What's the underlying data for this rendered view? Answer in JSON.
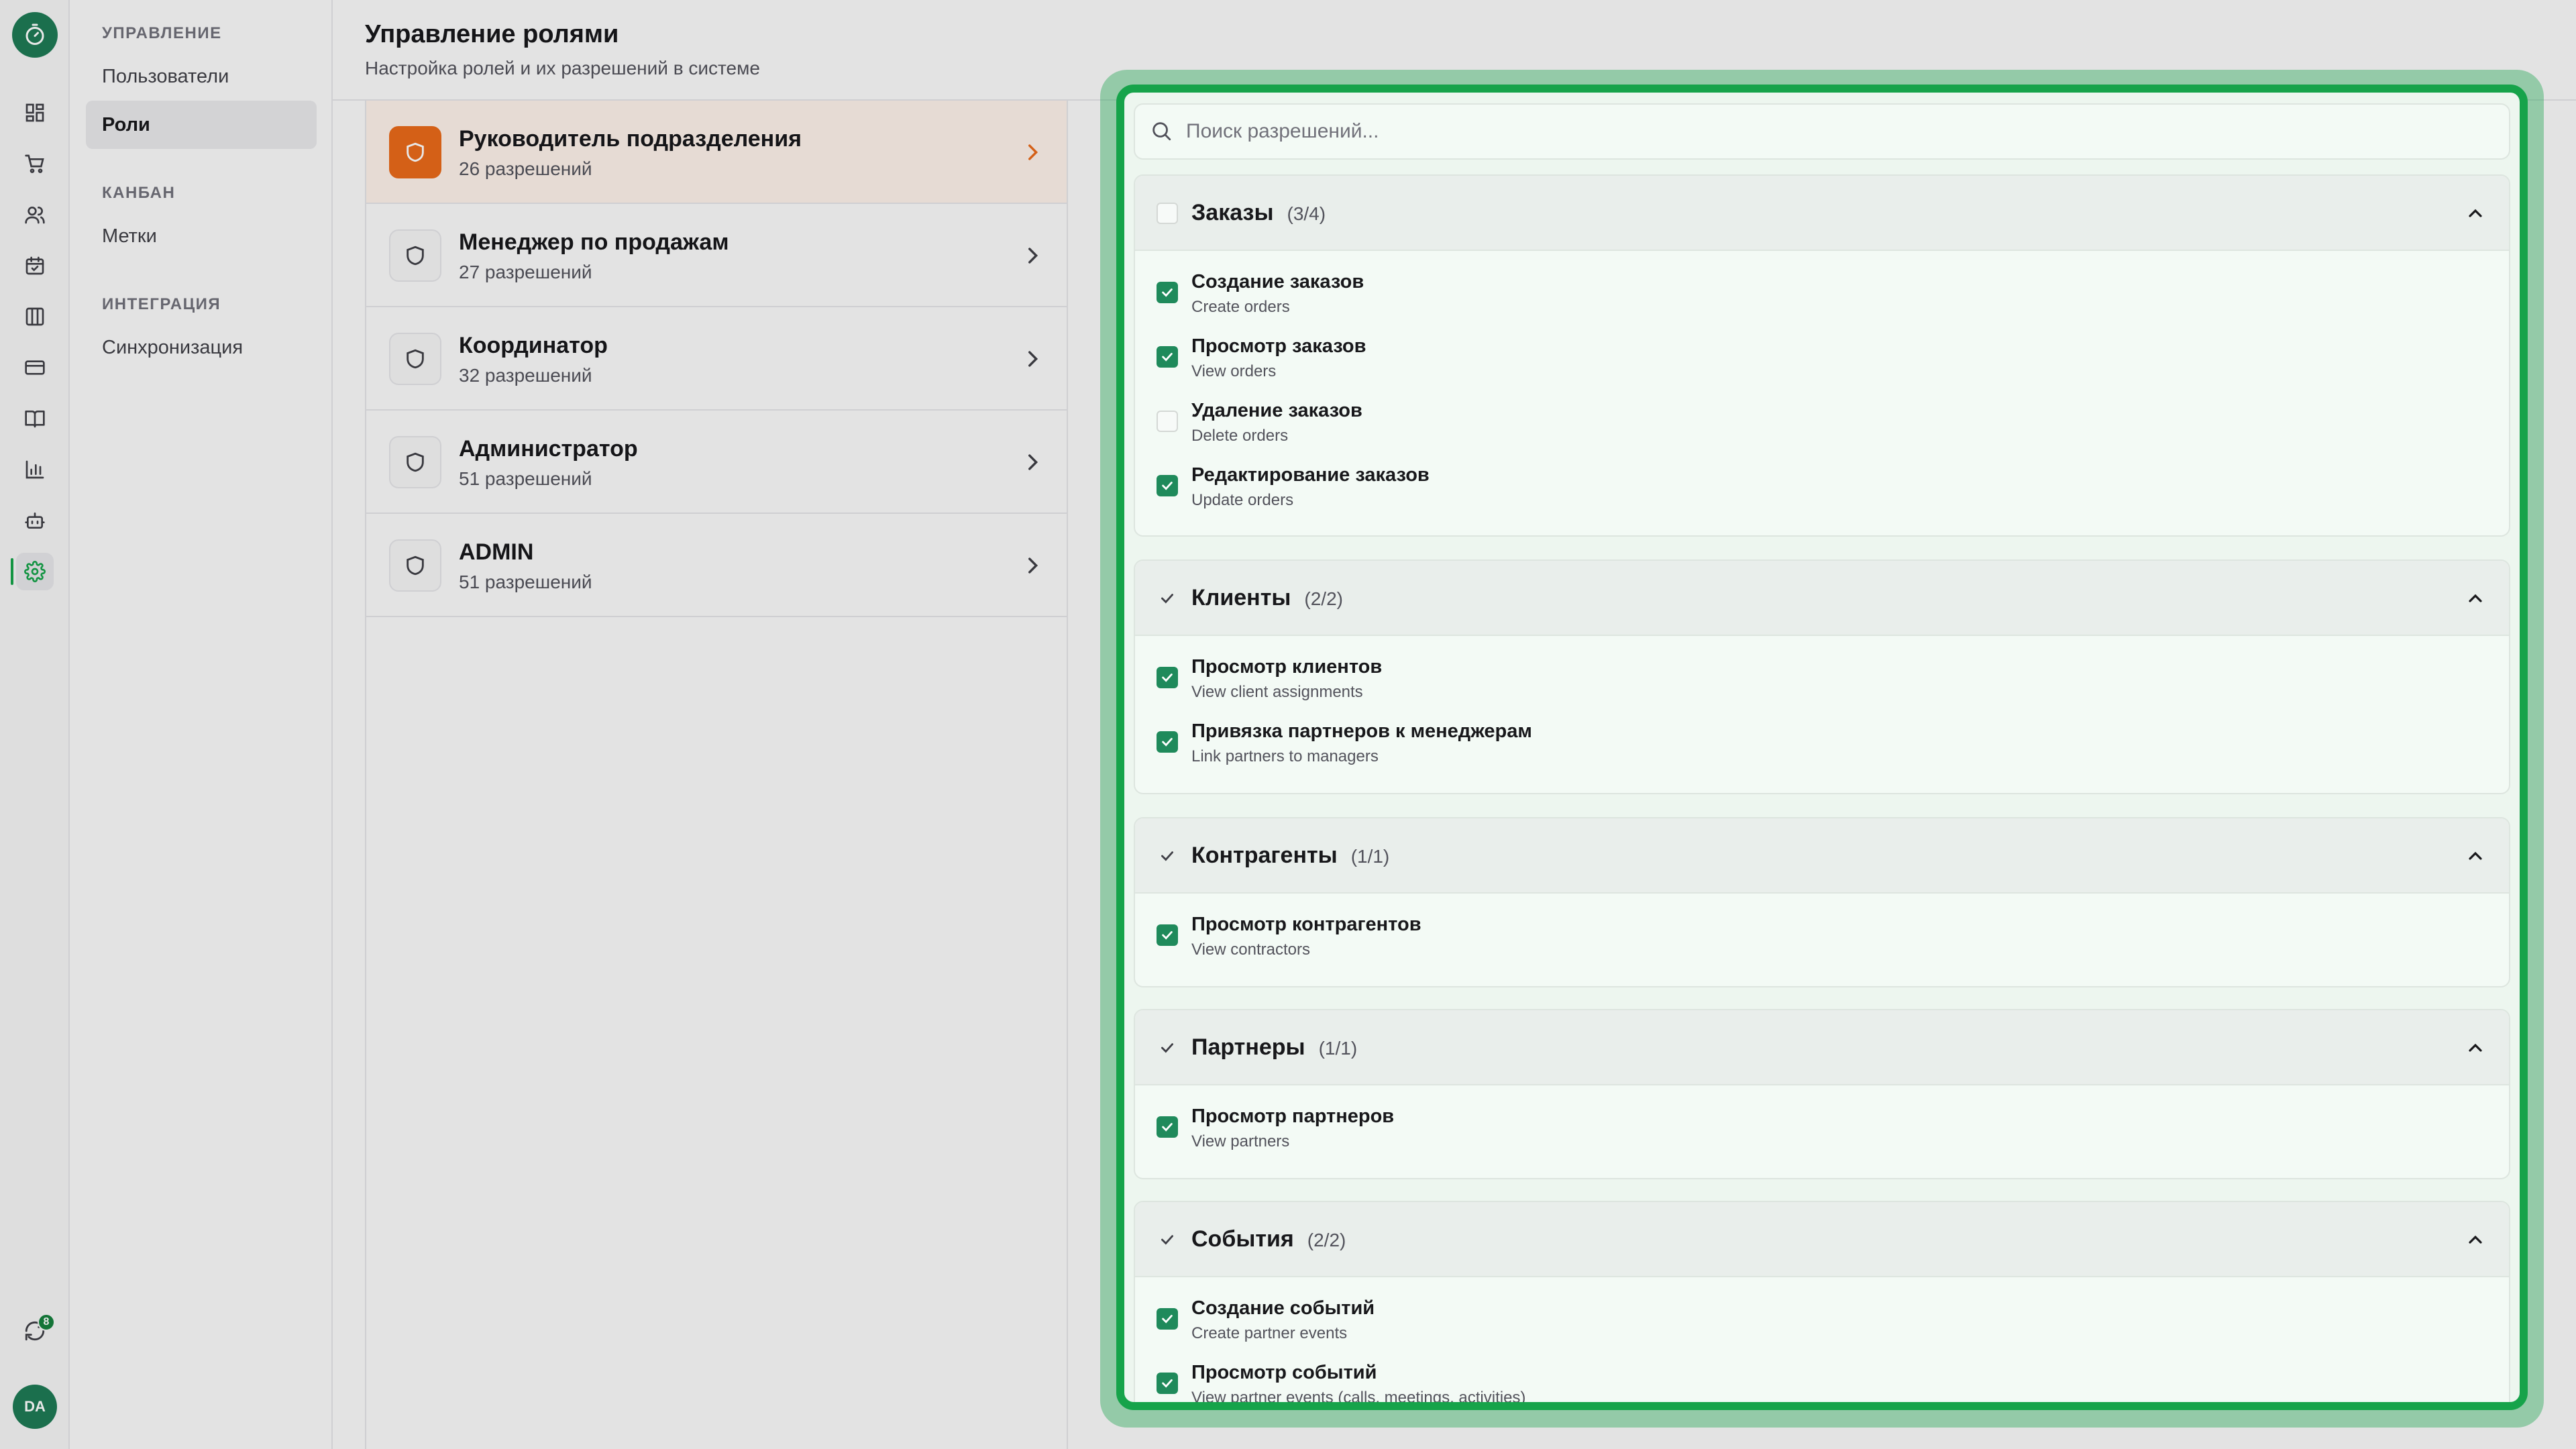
{
  "rail": {
    "icons": [
      "timer-logo-icon",
      "dashboard-icon",
      "cart-icon",
      "users-icon",
      "calendar-icon",
      "columns-icon",
      "card-icon",
      "book-icon",
      "chart-icon",
      "bot-icon",
      "settings-icon"
    ],
    "sync_badge": "8",
    "avatar_initials": "DA"
  },
  "nav": {
    "sections": [
      {
        "title": "УПРАВЛЕНИЕ",
        "items": [
          "Пользователи",
          "Роли"
        ]
      },
      {
        "title": "КАНБАН",
        "items": [
          "Метки"
        ]
      },
      {
        "title": "ИНТЕГРАЦИЯ",
        "items": [
          "Синхронизация"
        ]
      }
    ],
    "active_item": "Роли"
  },
  "header": {
    "title": "Управление ролями",
    "subtitle": "Настройка ролей и их разрешений в системе"
  },
  "roles": [
    {
      "name": "Руководитель подразделения",
      "count": "26 разрешений",
      "active": true
    },
    {
      "name": "Менеджер по продажам",
      "count": "27 разрешений",
      "active": false
    },
    {
      "name": "Координатор",
      "count": "32 разрешений",
      "active": false
    },
    {
      "name": "Администратор",
      "count": "51 разрешений",
      "active": false
    },
    {
      "name": "ADMIN",
      "count": "51 разрешений",
      "active": false
    }
  ],
  "permissions": {
    "search_placeholder": "Поиск разрешений...",
    "groups": [
      {
        "title": "Заказы",
        "count": "(3/4)",
        "state": "partial",
        "items": [
          {
            "name": "Создание заказов",
            "desc": "Create orders",
            "checked": true
          },
          {
            "name": "Просмотр заказов",
            "desc": "View orders",
            "checked": true
          },
          {
            "name": "Удаление заказов",
            "desc": "Delete orders",
            "checked": false
          },
          {
            "name": "Редактирование заказов",
            "desc": "Update orders",
            "checked": true
          }
        ]
      },
      {
        "title": "Клиенты",
        "count": "(2/2)",
        "state": "all",
        "items": [
          {
            "name": "Просмотр клиентов",
            "desc": "View client assignments",
            "checked": true
          },
          {
            "name": "Привязка партнеров к менеджерам",
            "desc": "Link partners to managers",
            "checked": true
          }
        ]
      },
      {
        "title": "Контрагенты",
        "count": "(1/1)",
        "state": "all",
        "items": [
          {
            "name": "Просмотр контрагентов",
            "desc": "View contractors",
            "checked": true
          }
        ]
      },
      {
        "title": "Партнеры",
        "count": "(1/1)",
        "state": "all",
        "items": [
          {
            "name": "Просмотр партнеров",
            "desc": "View partners",
            "checked": true
          }
        ]
      },
      {
        "title": "События",
        "count": "(2/2)",
        "state": "all",
        "items": [
          {
            "name": "Создание событий",
            "desc": "Create partner events",
            "checked": true
          },
          {
            "name": "Просмотр событий",
            "desc": "View partner events (calls, meetings, activities)",
            "checked": true
          }
        ]
      }
    ]
  },
  "colors": {
    "accent_green": "#16a34a",
    "checkbox_green": "#1f8a5b",
    "active_role_orange": "#ea6a1a"
  }
}
